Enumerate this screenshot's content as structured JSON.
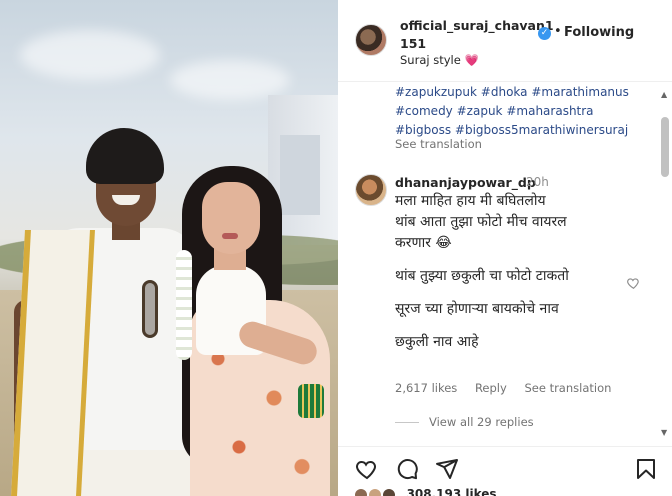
{
  "post": {
    "username": "official_suraj_chavan1151",
    "verified_mark": "✓",
    "separator": "•",
    "follow_state": "Following",
    "caption": "Suraj style",
    "caption_emoji": "💗",
    "hashtags": [
      "#zapukzupuk",
      "#dhoka",
      "#marathimanus",
      "#comedy",
      "#zapuk",
      "#maharashtra",
      "#bigboss",
      "#bigboss5marathiwinersuraj"
    ],
    "see_translation": "See translation"
  },
  "comment": {
    "username": "dhananjaypowar_dp",
    "time": "20h",
    "lines": [
      "मला माहित हाय मी बघितलोय",
      "थांब आता तुझा फोटो मीच वायरल",
      "करणार 😂",
      "थांब तुझ्या छकुली चा फोटो टाकतो",
      "सूरज च्या होणाऱ्या बायकोचे नाव",
      "छकुली नाव आहे"
    ],
    "likes": "2,617 likes",
    "reply": "Reply",
    "see_translation": "See translation",
    "view_replies": "View all 29 replies"
  },
  "footer": {
    "likes_partial": "308,193 likes"
  },
  "icons": {
    "heart": "heart-icon",
    "comment": "comment-icon",
    "share": "share-icon",
    "save": "bookmark-icon",
    "verified": "verified-badge-icon"
  },
  "colors": {
    "verified": "#3897f0",
    "hashtag": "#2b4a88",
    "muted": "#737373"
  }
}
